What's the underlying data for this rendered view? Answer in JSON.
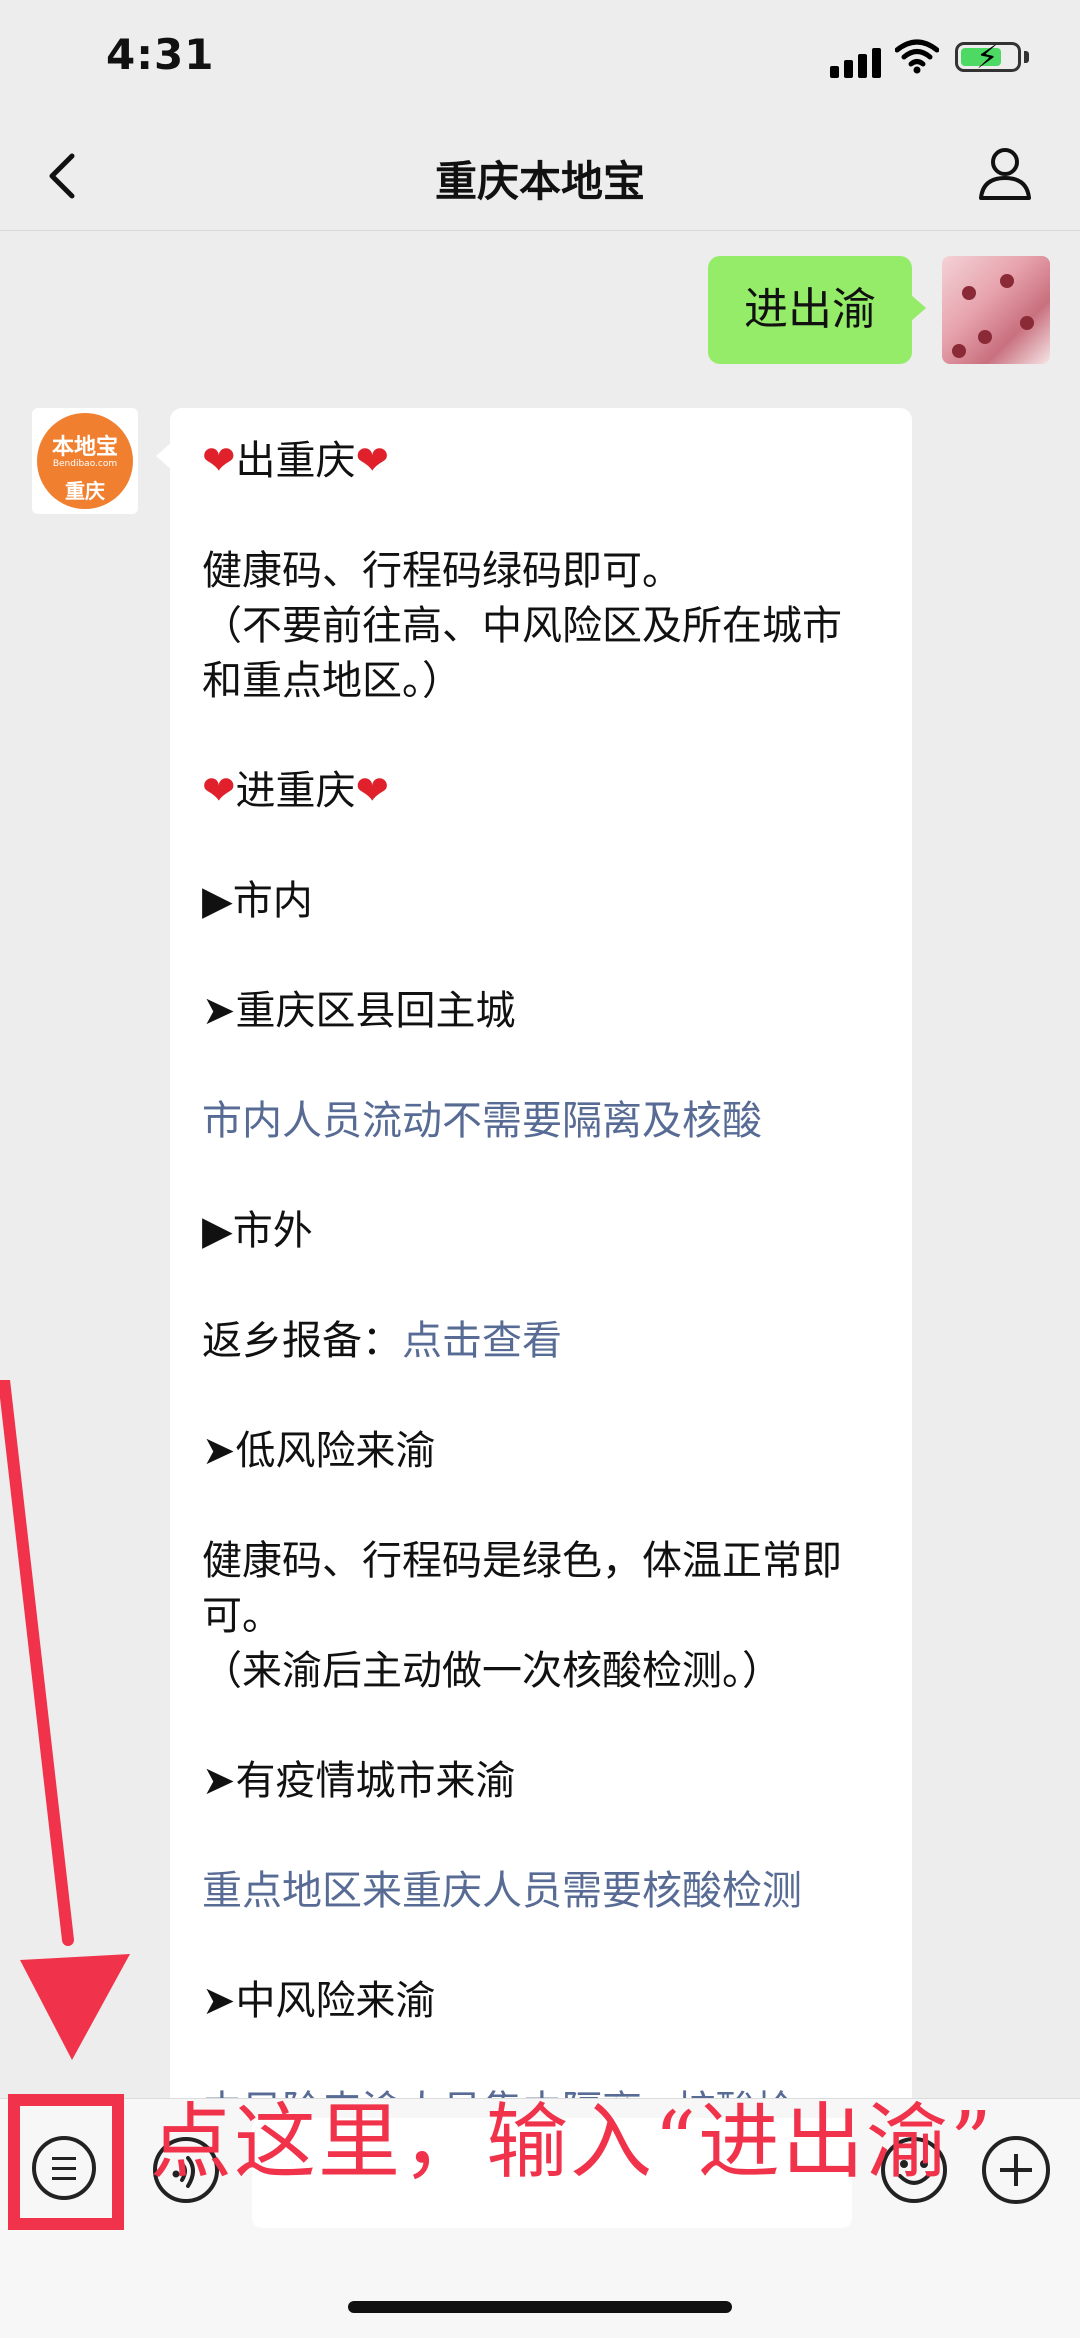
{
  "status_bar": {
    "time": "4:31"
  },
  "nav": {
    "title": "重庆本地宝"
  },
  "chat": {
    "sent_message": "进出渝",
    "official_account_avatar": {
      "top": "本地宝",
      "url": "Bendibao.com",
      "city": "重庆"
    },
    "received_message": {
      "heading_out": "出重庆",
      "out_text": "健康码、行程码绿码即可。\n（不要前往高、中风险区及所在城市和重点地区。）",
      "heading_in": "进重庆",
      "city_inside": "▶市内",
      "district_return": "➤重庆区县回主城",
      "inside_note": "市内人员流动不需要隔离及核酸",
      "city_outside": "▶市外",
      "return_report_label": "返乡报备：",
      "return_report_link": "点击查看",
      "low_risk": "➤低风险来渝",
      "low_risk_text": "健康码、行程码是绿色，体温正常即可。\n（来渝后主动做一次核酸检测。）",
      "epidemic_city": "➤有疫情城市来渝",
      "epidemic_note": "重点地区来重庆人员需要核酸检测",
      "medium_risk": "➤中风险来渝",
      "medium_note_partial": "中风险来渝人员集中隔离+核酸检"
    }
  },
  "annotation": {
    "text": "点这里，输入“进出渝”",
    "color": "#f0334a"
  },
  "colors": {
    "sent_bubble": "#95ec69",
    "link": "#576b95",
    "background": "#ededed"
  }
}
